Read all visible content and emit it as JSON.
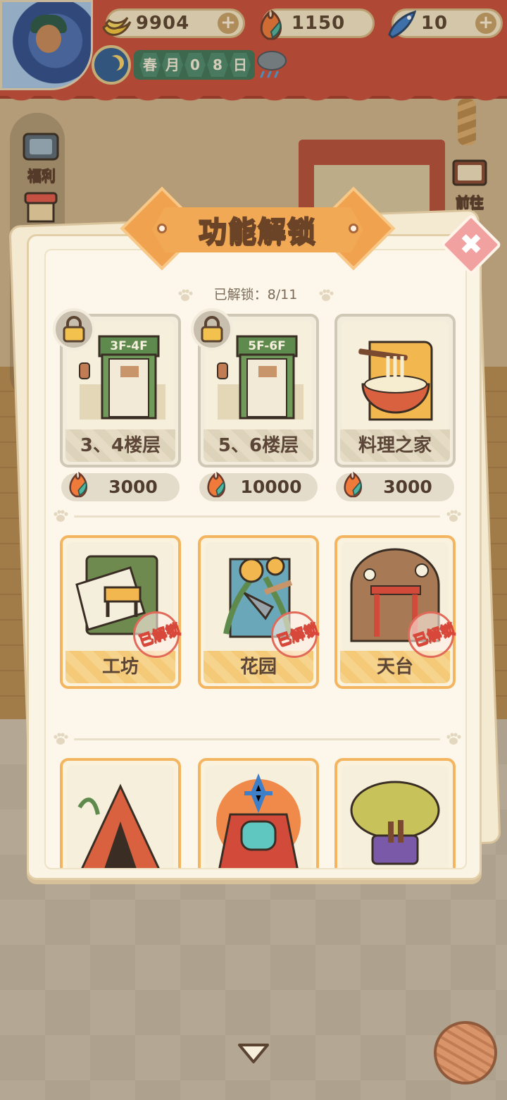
{
  "hud": {
    "bananas": "9904",
    "fire_gems": "1150",
    "fish": "10",
    "season_char": "春",
    "month_char": "月",
    "day_digits": [
      "0",
      "8"
    ],
    "day_char": "日"
  },
  "secondary_bar": {
    "bananas": "9904",
    "fire_gems": "1150"
  },
  "side_left": {
    "welfare_label": "福利",
    "shop_label": "商"
  },
  "side_right": {
    "goto_label": "前往"
  },
  "panel": {
    "title": "功能解锁",
    "unlocked_counter": "已解锁：8/11",
    "close_symbol": "✖",
    "stamp_text": "已解锁",
    "locked_cards": [
      {
        "name": "3、4楼层",
        "sign": "3F-4F",
        "cost": "3000",
        "locked": true
      },
      {
        "name": "5、6楼层",
        "sign": "5F-6F",
        "cost": "10000",
        "locked": true
      },
      {
        "name": "料理之家",
        "cost": "3000",
        "locked": false
      }
    ],
    "unlocked_cards": [
      {
        "name": "工坊"
      },
      {
        "name": "花园"
      },
      {
        "name": "天台"
      }
    ]
  },
  "colors": {
    "accent_orange": "#f2a955",
    "unlocked_border": "#f3b55f",
    "stamp_red": "#e26a5a"
  },
  "icons": [
    "banana-icon",
    "fire-gem-icon",
    "fish-icon",
    "plus-icon",
    "moon-icon",
    "rain-cloud-icon",
    "lock-icon",
    "paw-icon",
    "close-icon",
    "chevron-down-icon",
    "yarn-ball-icon"
  ]
}
